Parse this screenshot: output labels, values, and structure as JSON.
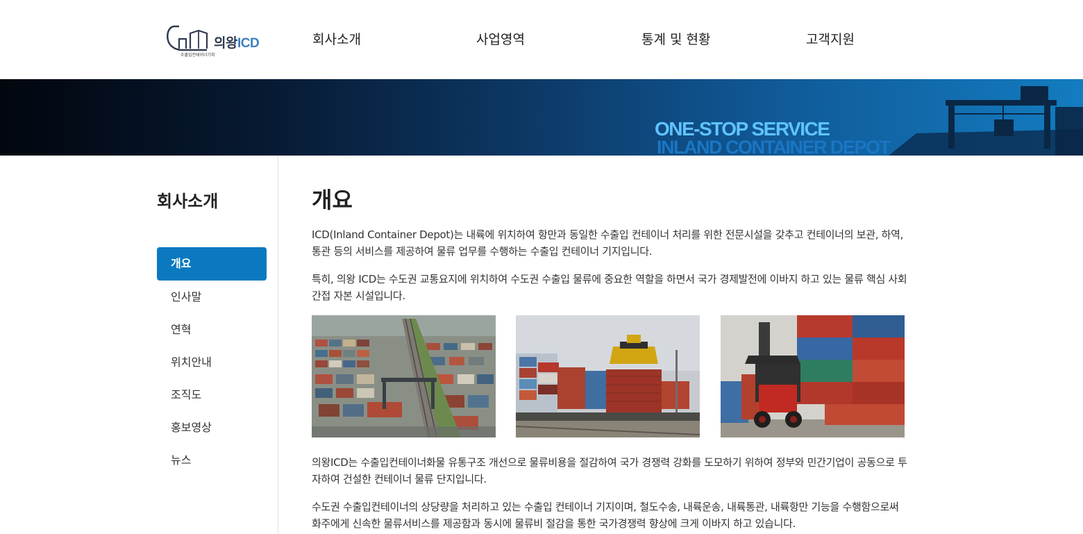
{
  "header": {
    "logo": {
      "brand": "의왕",
      "brand_suffix": "ICD",
      "subtitle": "수출입컨테이너기지"
    },
    "nav": [
      {
        "label": "회사소개"
      },
      {
        "label": "사업영역"
      },
      {
        "label": "통계 및 현황"
      },
      {
        "label": "고객지원"
      }
    ]
  },
  "banner": {
    "title": "ONE-STOP SERVICE",
    "subtitle": "INLAND CONTAINER DEPOT",
    "colors": {
      "title": "#5fc3ff",
      "subtitle": "#1a76c4",
      "gradient_end": "#137cc0"
    }
  },
  "sidebar": {
    "title": "회사소개",
    "items": [
      {
        "label": "개요",
        "active": true
      },
      {
        "label": "인사말",
        "active": false
      },
      {
        "label": "연혁",
        "active": false
      },
      {
        "label": "위치안내",
        "active": false
      },
      {
        "label": "조직도",
        "active": false
      },
      {
        "label": "홍보영상",
        "active": false
      },
      {
        "label": "뉴스",
        "active": false
      }
    ],
    "active_color": "#0a79c0"
  },
  "main": {
    "title": "개요",
    "paragraphs": [
      "ICD(Inland Container Depot)는 내륙에 위치하여 항만과 동일한 수출입 컨테이너 처리를 위한 전문시설을 갖추고 컨테이너의 보관, 하역, 통관 등의 서비스를 제공하여 물류 업무를 수행하는 수출입 컨테이너 기지입니다.",
      "특히, 의왕 ICD는 수도권 교통요지에 위치하여 수도권 수출입 물류에 중요한 역할을 하면서 국가 경제발전에 이바지 하고 있는 물류 핵심 사회 간접 자본 시설입니다.",
      "의왕ICD는 수출입컨테이너화물 유통구조 개선으로 물류비용을 절감하여 국가 경쟁력 강화를 도모하기 위하여 정부와 민간기업이 공동으로 투자하여 건설한 컨테이너 물류 단지입니다.",
      "수도권 수출입컨테이너의 상당량을 처리하고 있는 수출입 컨테이너 기지이며, 철도수송, 내륙운송, 내륙통관, 내륙항만 기능을 수행함으로써 화주에게 신속한 물류서비스를 제공함과 동시에 물류비 절감을 통한 국가경쟁력 향상에 크게 이바지 하고 있습니다."
    ],
    "photos": [
      {
        "subject": "aerial-container-yard-photo"
      },
      {
        "subject": "rail-container-loading-photo"
      },
      {
        "subject": "reach-stacker-containers-photo"
      }
    ]
  }
}
